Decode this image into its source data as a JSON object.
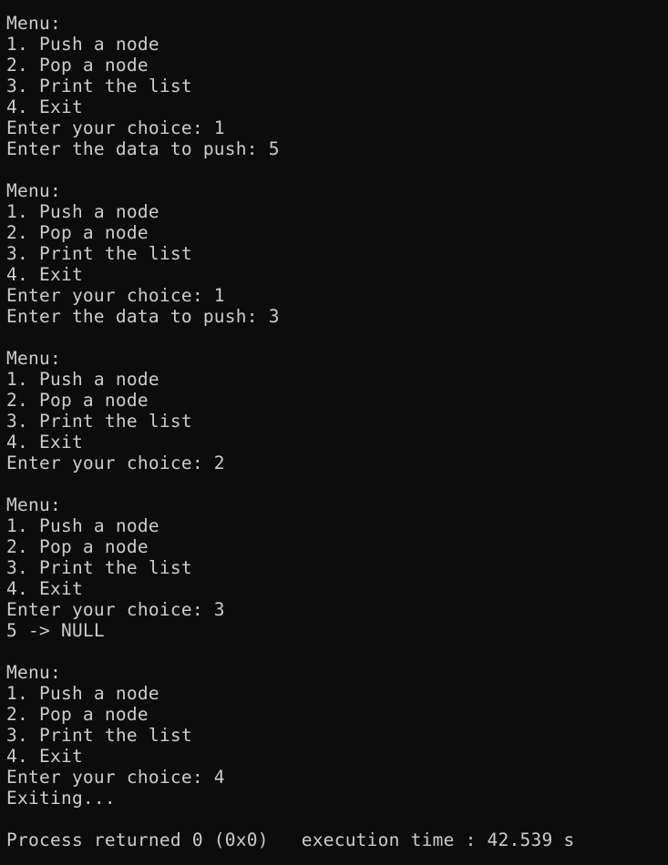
{
  "console": {
    "lines": [
      "Menu:",
      "1. Push a node",
      "2. Pop a node",
      "3. Print the list",
      "4. Exit",
      "Enter your choice: 1",
      "Enter the data to push: 5",
      "",
      "Menu:",
      "1. Push a node",
      "2. Pop a node",
      "3. Print the list",
      "4. Exit",
      "Enter your choice: 1",
      "Enter the data to push: 3",
      "",
      "Menu:",
      "1. Push a node",
      "2. Pop a node",
      "3. Print the list",
      "4. Exit",
      "Enter your choice: 2",
      "",
      "Menu:",
      "1. Push a node",
      "2. Pop a node",
      "3. Print the list",
      "4. Exit",
      "Enter your choice: 3",
      "5 -> NULL",
      "",
      "Menu:",
      "1. Push a node",
      "2. Pop a node",
      "3. Print the list",
      "4. Exit",
      "Enter your choice: 4",
      "Exiting...",
      "",
      "Process returned 0 (0x0)   execution time : 42.539 s"
    ]
  }
}
